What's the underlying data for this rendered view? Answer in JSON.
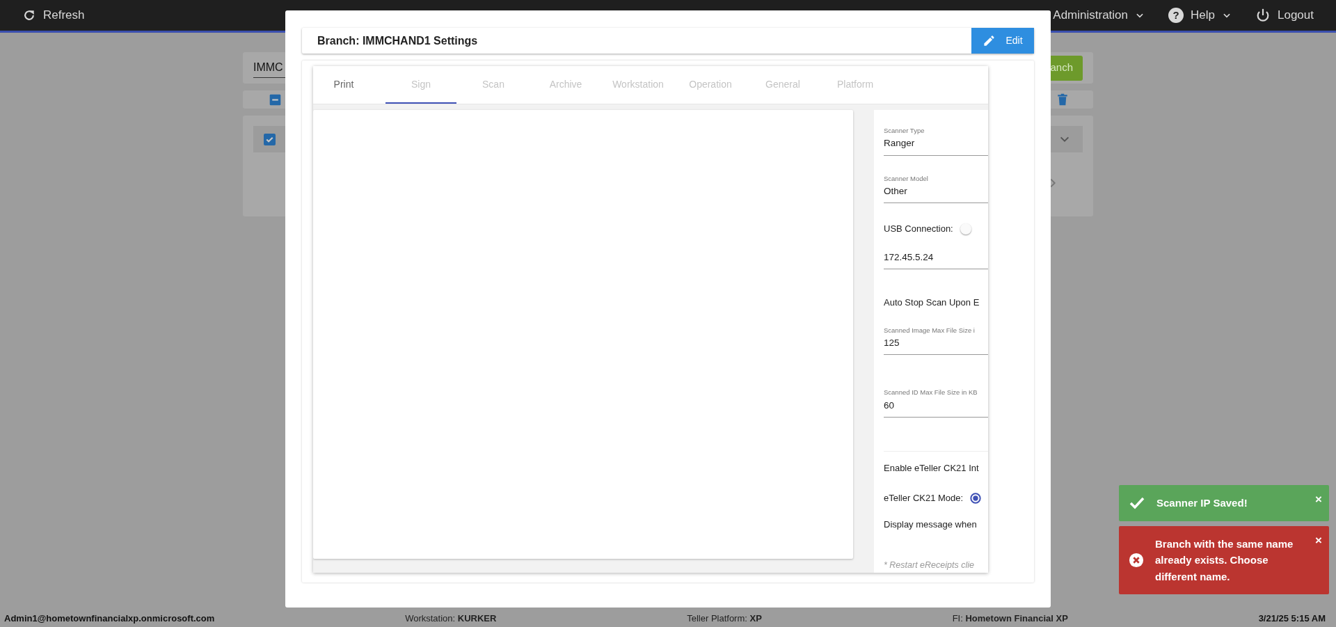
{
  "navbar": {
    "items": [
      {
        "label": "Refresh",
        "kind": "refresh"
      },
      {
        "label": "Administration",
        "kind": "dropdown"
      },
      {
        "label": "Help",
        "kind": "help",
        "icon_text": "?"
      },
      {
        "label": "Logout",
        "kind": "logout"
      }
    ]
  },
  "background": {
    "search_value": "IMMC",
    "search_button": "anch",
    "select_all": {
      "partial": true
    },
    "list_item": {
      "checked": true
    }
  },
  "modal": {
    "title": "Branch: IMMCHAND1 Settings",
    "edit_button": "Edit",
    "tabs": [
      {
        "label": "Print",
        "selected": false,
        "disabled": false
      },
      {
        "label": "Sign",
        "selected": true,
        "disabled": true
      },
      {
        "label": "Scan",
        "selected": false,
        "disabled": true
      },
      {
        "label": "Archive",
        "selected": false,
        "disabled": true
      },
      {
        "label": "Workstation",
        "selected": false,
        "disabled": true
      },
      {
        "label": "Operation",
        "selected": false,
        "disabled": true
      },
      {
        "label": "General",
        "selected": false,
        "disabled": true
      },
      {
        "label": "Platform",
        "selected": false,
        "disabled": true
      }
    ],
    "scanner_settings": [
      {
        "kind": "select",
        "label": "Scanner Type",
        "value": "Ranger"
      },
      {
        "kind": "select",
        "label": "Scanner Model",
        "value": "Other"
      },
      {
        "kind": "toggle",
        "label": "USB Connection:",
        "on": false
      },
      {
        "kind": "input",
        "value": "172.45.5.24"
      },
      {
        "kind": "text",
        "label": "Auto Stop Scan Upon E"
      },
      {
        "kind": "select",
        "label": "Scanned Image Max File Size i",
        "value": "125"
      },
      {
        "kind": "select",
        "label": "Scanned ID Max File Size in KB",
        "value": "60"
      },
      {
        "kind": "divider"
      },
      {
        "kind": "text",
        "label": "Enable eTeller CK21 Int"
      },
      {
        "kind": "radio",
        "label": "eTeller CK21 Mode:",
        "selected": true
      },
      {
        "kind": "text",
        "label": "Display message when"
      },
      {
        "kind": "note",
        "label": "* Restart eReceipts clie"
      }
    ]
  },
  "toasts": [
    {
      "kind": "success",
      "text": "Scanner IP Saved!",
      "close": "×"
    },
    {
      "kind": "error",
      "text": "Branch with the same name already exists. Choose different name.",
      "close": "×"
    }
  ],
  "footer": [
    {
      "text": "Admin1@hometownfinancialxp.onmicrosoft.com",
      "kind": "user"
    },
    {
      "text": "Workstation: **KURKER**",
      "kind": "info"
    },
    {
      "text": "Teller Platform: **XP**",
      "kind": "info"
    },
    {
      "text": "FI: **Hometown Financial XP**",
      "kind": "info"
    },
    {
      "text": "3/21/25 5:15 AM",
      "kind": "time"
    }
  ]
}
